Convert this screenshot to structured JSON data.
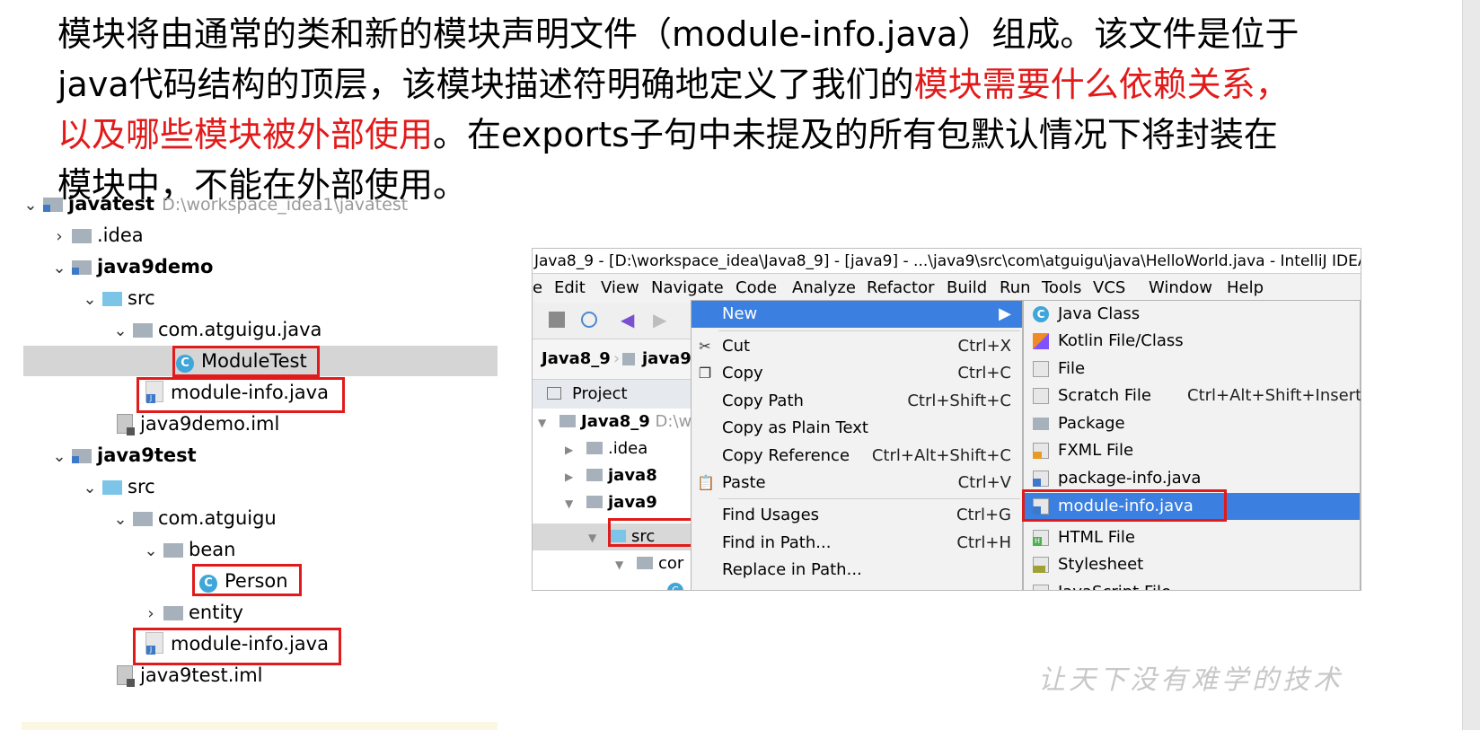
{
  "slide": {
    "line1": "模块将由通常的类和新的模块声明文件（module-info.java）组成。该文件是位于",
    "line2_plain": "java代码结构的顶层，该模块描述符明确地定义了我们的",
    "line2_red": "模块需要什么依赖关系，",
    "line3_red": "以及哪些模块被外部使用",
    "line3_plain": "。在exports子句中未提及的所有包默认情况下将封装在",
    "line4": "模块中，不能在外部使用。"
  },
  "tree": {
    "root_name": "javatest",
    "root_path": "D:\\workspace_idea1\\javatest",
    "items": [
      {
        "label": "javatest"
      },
      {
        "label": ".idea"
      },
      {
        "label": "java9demo"
      },
      {
        "label": "src"
      },
      {
        "label": "com.atguigu.java"
      },
      {
        "label": "ModuleTest"
      },
      {
        "label": "module-info.java"
      },
      {
        "label": "java9demo.iml"
      },
      {
        "label": "java9test"
      },
      {
        "label": "src"
      },
      {
        "label": "com.atguigu"
      },
      {
        "label": "bean"
      },
      {
        "label": "Person"
      },
      {
        "label": "entity"
      },
      {
        "label": "module-info.java"
      },
      {
        "label": "java9test.iml"
      }
    ],
    "class_icon_letter": "C"
  },
  "ide": {
    "title": "Java8_9 - [D:\\workspace_idea\\Java8_9] - [java9] - ...\\java9\\src\\com\\atguigu\\java\\HelloWorld.java - IntelliJ IDEA",
    "menu": [
      "e",
      "Edit",
      "View",
      "Navigate",
      "Code",
      "Analyze",
      "Refactor",
      "Build",
      "Run",
      "Tools",
      "VCS",
      "Window",
      "Help"
    ],
    "crumbs": [
      "Java8_9",
      "java9"
    ],
    "project_tab": "Project",
    "project_tree": [
      {
        "label": "Java8_9",
        "path": "D:\\w"
      },
      {
        "label": ".idea"
      },
      {
        "label": "java8"
      },
      {
        "label": "java9"
      },
      {
        "label": "src"
      },
      {
        "label": "cor"
      }
    ],
    "context_menu": [
      {
        "label": "New",
        "shortcut": ""
      },
      {
        "label": "Cut",
        "shortcut": "Ctrl+X"
      },
      {
        "label": "Copy",
        "shortcut": "Ctrl+C"
      },
      {
        "label": "Copy Path",
        "shortcut": "Ctrl+Shift+C"
      },
      {
        "label": "Copy as Plain Text",
        "shortcut": ""
      },
      {
        "label": "Copy Reference",
        "shortcut": "Ctrl+Alt+Shift+C"
      },
      {
        "label": "Paste",
        "shortcut": "Ctrl+V"
      },
      {
        "label": "Find Usages",
        "shortcut": "Ctrl+G"
      },
      {
        "label": "Find in Path...",
        "shortcut": "Ctrl+H"
      },
      {
        "label": "Replace in Path...",
        "shortcut": ""
      }
    ],
    "new_submenu": [
      {
        "label": "Java Class",
        "shortcut": ""
      },
      {
        "label": "Kotlin File/Class",
        "shortcut": ""
      },
      {
        "label": "File",
        "shortcut": ""
      },
      {
        "label": "Scratch File",
        "shortcut": "Ctrl+Alt+Shift+Insert"
      },
      {
        "label": "Package",
        "shortcut": ""
      },
      {
        "label": "FXML File",
        "shortcut": ""
      },
      {
        "label": "package-info.java",
        "shortcut": ""
      },
      {
        "label": "module-info.java",
        "shortcut": ""
      },
      {
        "label": "HTML File",
        "shortcut": ""
      },
      {
        "label": "Stylesheet",
        "shortcut": ""
      },
      {
        "label": "JavaScript File",
        "shortcut": ""
      }
    ],
    "class_icon_letter": "C"
  },
  "watermark": "让天下没有难学的技术",
  "colors": {
    "highlight_red": "#e21a1a",
    "annotation_box": "#e11b1b",
    "menu_highlight": "#3b7fe0",
    "selected_row": "#d5d5d5",
    "folder_blue": "#7cc5e8"
  }
}
